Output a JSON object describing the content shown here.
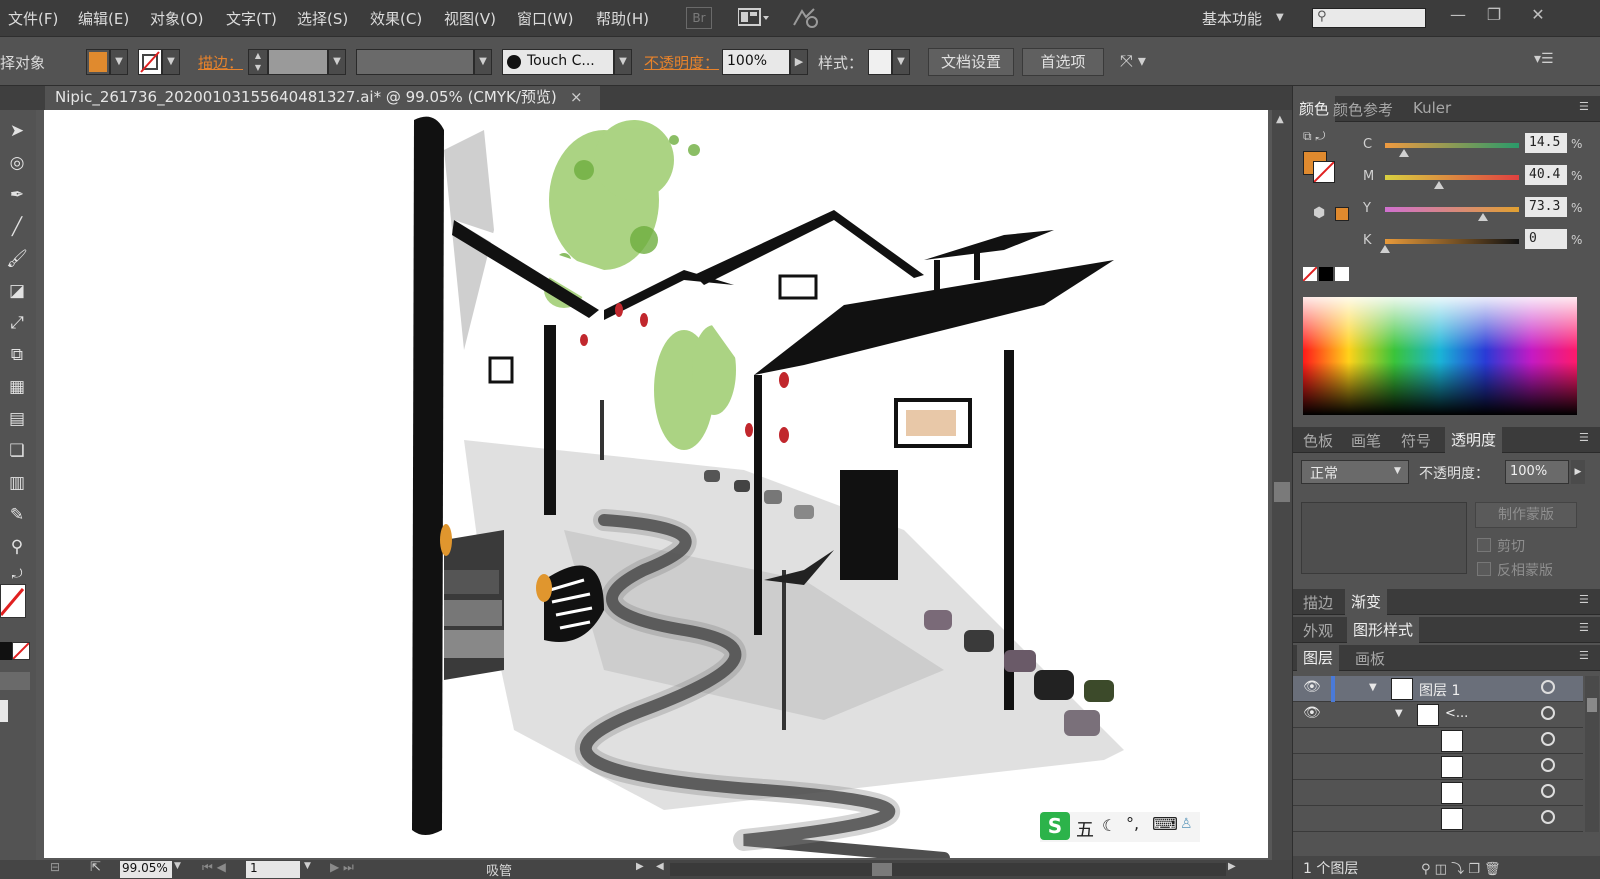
{
  "menu": {
    "file": "文件(F)",
    "edit": "编辑(E)",
    "object": "对象(O)",
    "type": "文字(T)",
    "select": "选择(S)",
    "effect": "效果(C)",
    "view": "视图(V)",
    "window": "窗口(W)",
    "help": "帮助(H)",
    "bridge": "Br",
    "workspace": "基本功能"
  },
  "control_bar": {
    "selection_label": "择对象",
    "stroke_label": "描边：",
    "brush_name": "Touch C...",
    "opacity_label": "不透明度：",
    "opacity_value": "100%",
    "style_label": "样式：",
    "doc_setup": "文档设置",
    "preferences": "首选项",
    "colors": {
      "fill": "#e08a2e",
      "label_link": "#e8832b"
    }
  },
  "document": {
    "tab_title": "Nipic_261736_20200103155640481327.ai* @ 99.05% (CMYK/预览)",
    "close": "×"
  },
  "status": {
    "zoom": "99.05%",
    "artboard_num": "1",
    "tool_name": "吸管"
  },
  "color_panel": {
    "tabs": [
      "颜色",
      "颜色参考",
      "Kuler"
    ],
    "sliders": [
      {
        "label": "C",
        "value": "14.5",
        "level": 0.145
      },
      {
        "label": "M",
        "value": "40.4",
        "level": 0.404
      },
      {
        "label": "Y",
        "value": "73.3",
        "level": 0.733
      },
      {
        "label": "K",
        "value": "0",
        "level": 0
      }
    ],
    "percent": "%",
    "fill_color": "#e08a2e"
  },
  "transparency_panel": {
    "tabs": [
      "色板",
      "画笔",
      "符号",
      "透明度"
    ],
    "blend_mode": "正常",
    "opacity_label": "不透明度：",
    "opacity_value": "100%",
    "make_mask": "制作蒙版",
    "clip": "剪切",
    "invert_mask": "反相蒙版"
  },
  "stroke_panel": {
    "tabs": [
      "描边",
      "渐变"
    ]
  },
  "appearance_panel": {
    "tabs": [
      "外观",
      "图形样式"
    ]
  },
  "layers_panel": {
    "tabs": [
      "图层",
      "画板"
    ],
    "layer_name": "图层 1",
    "sublayer_name": "<...",
    "count": "1 个图层"
  },
  "ime": {
    "mode": "五"
  }
}
